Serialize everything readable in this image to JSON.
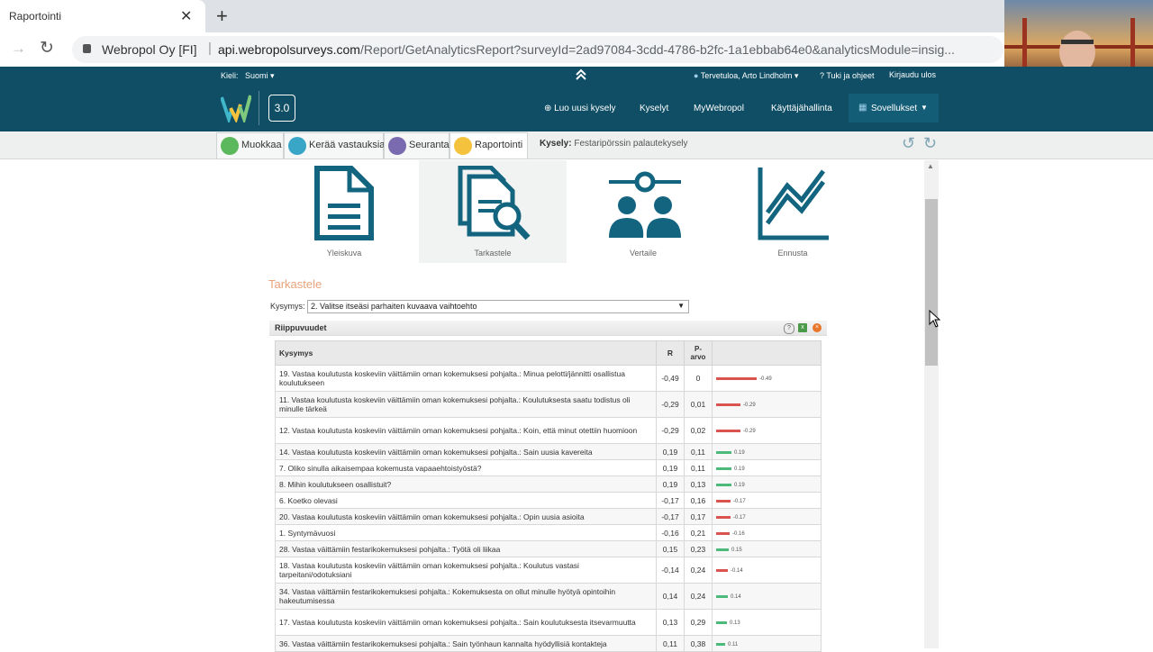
{
  "browser": {
    "tab_title": "Raportointi",
    "close_glyph": "✕",
    "new_tab_glyph": "+",
    "site_name": "Webropol Oy [FI]",
    "url_host": "api.webropolsurveys.com",
    "url_path": "/Report/GetAnalyticsReport?surveyId=2ad97084-3cdd-4786-b2fc-1a1ebbab64e0&analyticsModule=insig..."
  },
  "header": {
    "language_label": "Kieli:",
    "language_value": "Suomi ▾",
    "user": "Tervetuloa, Arto Lindholm ▾",
    "help": "Tuki ja ohjeet",
    "logout": "Kirjaudu ulos",
    "version": "3.0",
    "menu": {
      "new_survey": "Luo uusi kysely",
      "surveys": "Kyselyt",
      "my": "MyWebropol",
      "users": "Käyttäjähallinta",
      "apps": "Sovellukset"
    }
  },
  "toolbar": {
    "edit": "Muokkaa",
    "collect": "Kerää vastauksia",
    "follow": "Seuranta",
    "report": "Raportointi",
    "survey_label": "Kysely:",
    "survey_name": "Festaripörssin palautekysely"
  },
  "modules": {
    "overview": "Yleiskuva",
    "inspect": "Tarkastele",
    "compare": "Vertaile",
    "forecast": "Ennusta"
  },
  "section": {
    "title": "Tarkastele",
    "question_label": "Kysymys:",
    "question_value": "2. Valitse itseäsi parhaiten kuvaava vaihtoehto"
  },
  "panel": {
    "title": "Riippuvuudet",
    "col_question": "Kysymys",
    "col_r": "R",
    "col_p": "P-arvo",
    "rows": [
      {
        "q": "19. Vastaa koulutusta koskeviin väittämiin oman kokemuksesi pohjalta.: Minua pelotti/jännitti osallistua koulutukseen",
        "r": "-0,49",
        "p": "0",
        "v": -0.49,
        "label": "-0.49"
      },
      {
        "q": "11. Vastaa koulutusta koskeviin väittämiin oman kokemuksesi pohjalta.: Koulutuksesta saatu todistus oli minulle tärkeä",
        "r": "-0,29",
        "p": "0,01",
        "v": -0.29,
        "label": "-0.29"
      },
      {
        "q": "12. Vastaa koulutusta koskeviin väittämiin oman kokemuksesi pohjalta.: Koin, että minut otettiin huomioon",
        "r": "-0,29",
        "p": "0,02",
        "v": -0.29,
        "label": "-0.29"
      },
      {
        "q": "14. Vastaa koulutusta koskeviin väittämiin oman kokemuksesi pohjalta.: Sain uusia kavereita",
        "r": "0,19",
        "p": "0,11",
        "v": 0.19,
        "label": "0.19"
      },
      {
        "q": "7. Oliko sinulla aikaisempaa kokemusta vapaaehtoistyöstä?",
        "r": "0,19",
        "p": "0,11",
        "v": 0.19,
        "label": "0.19"
      },
      {
        "q": "8. Mihin koulutukseen osallistuit?",
        "r": "0,19",
        "p": "0,13",
        "v": 0.19,
        "label": "0.19"
      },
      {
        "q": "6. Koetko olevasi",
        "r": "-0,17",
        "p": "0,16",
        "v": -0.17,
        "label": "-0.17"
      },
      {
        "q": "20. Vastaa koulutusta koskeviin väittämiin oman kokemuksesi pohjalta.: Opin uusia asioita",
        "r": "-0,17",
        "p": "0,17",
        "v": -0.17,
        "label": "-0.17"
      },
      {
        "q": "1. Syntymävuosi",
        "r": "-0,16",
        "p": "0,21",
        "v": -0.16,
        "label": "-0.16"
      },
      {
        "q": "28. Vastaa väittämiin festarikokemuksesi pohjalta.: Työtä oli liikaa",
        "r": "0,15",
        "p": "0,23",
        "v": 0.15,
        "label": "0.15"
      },
      {
        "q": "18. Vastaa koulutusta koskeviin väittämiin oman kokemuksesi pohjalta.: Koulutus vastasi tarpeitani/odotuksiani",
        "r": "-0,14",
        "p": "0,24",
        "v": -0.14,
        "label": "-0.14"
      },
      {
        "q": "34. Vastaa väittämiin festarikokemuksesi pohjalta.: Kokemuksesta on ollut minulle hyötyä opintoihin hakeutumisessa",
        "r": "0,14",
        "p": "0,24",
        "v": 0.14,
        "label": "0.14"
      },
      {
        "q": "17. Vastaa koulutusta koskeviin väittämiin oman kokemuksesi pohjalta.: Sain koulutuksesta itsevarmuutta",
        "r": "0,13",
        "p": "0,29",
        "v": 0.13,
        "label": "0.13"
      },
      {
        "q": "36. Vastaa väittämiin festarikokemuksesi pohjalta.: Sain työnhaun kannalta hyödyllisiä kontakteja",
        "r": "0,11",
        "p": "0,38",
        "v": 0.11,
        "label": "0.11"
      }
    ]
  },
  "colors": {
    "header_teal": "#0f4e64",
    "accent_orange": "#e8a37a",
    "negative": "#d9534f",
    "positive": "#4cba7a"
  }
}
